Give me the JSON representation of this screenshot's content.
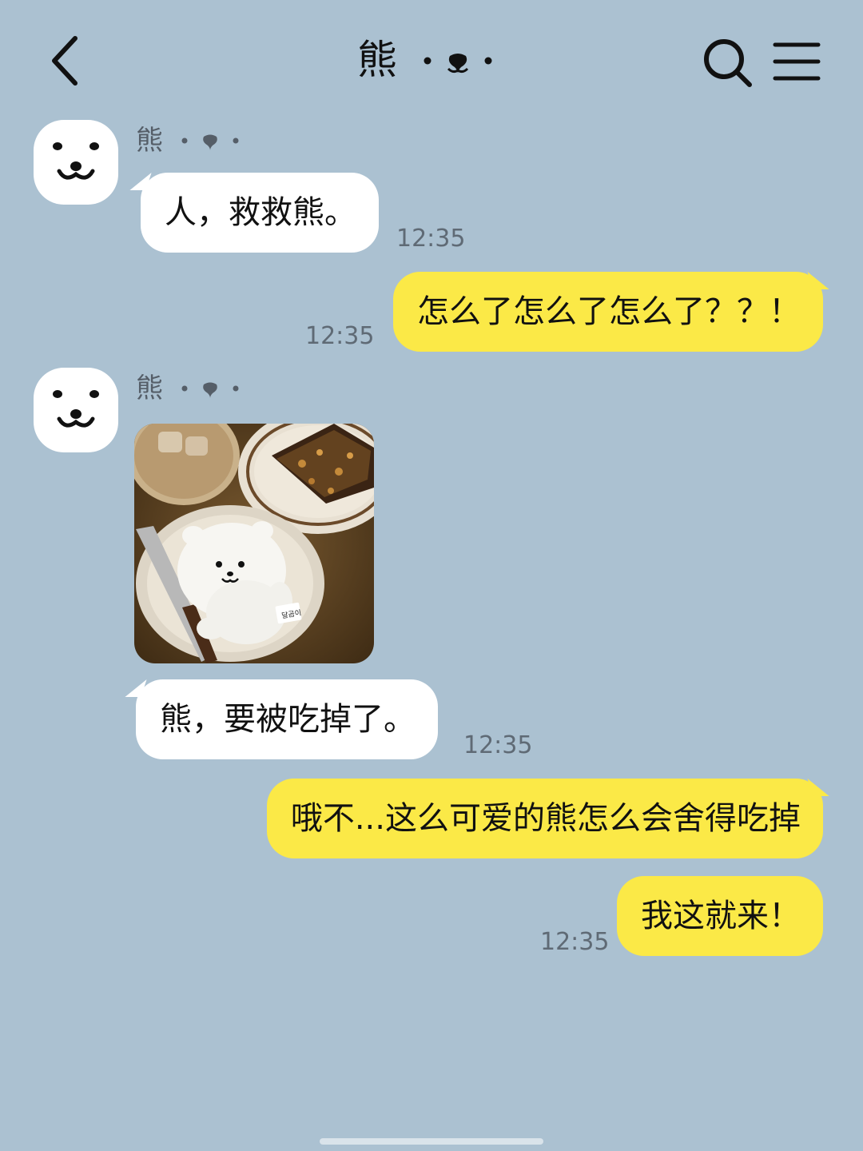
{
  "header": {
    "title": "熊",
    "back_icon": "chevron-left-icon",
    "search_icon": "search-icon",
    "menu_icon": "menu-icon"
  },
  "contact": {
    "name": "熊"
  },
  "messages": [
    {
      "direction": "in",
      "text": "人，救救熊。",
      "time": "12:35"
    },
    {
      "direction": "out",
      "text": "怎么了怎么了怎么了？？！",
      "time": "12:35"
    },
    {
      "direction": "in",
      "type": "image",
      "image_label": "달곰이"
    },
    {
      "direction": "in",
      "text": "熊，要被吃掉了。",
      "time": "12:35"
    },
    {
      "direction": "out",
      "text": "哦不...这么可爱的熊怎么会舍得吃掉",
      "time": ""
    },
    {
      "direction": "out",
      "text": "我这就来！",
      "time": "12:35"
    }
  ],
  "colors": {
    "background": "#abc1d1",
    "outgoing": "#fbe947",
    "incoming": "#ffffff"
  }
}
